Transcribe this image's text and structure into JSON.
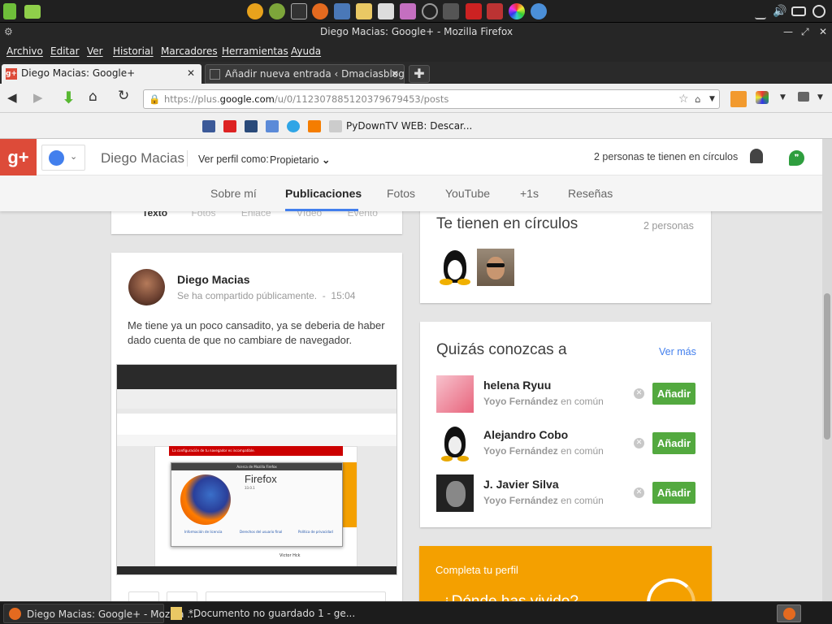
{
  "window": {
    "title": "Diego Macias: Google+ - Mozilla Firefox"
  },
  "menu": [
    "Archivo",
    "Editar",
    "Ver",
    "Historial",
    "Marcadores",
    "Herramientas",
    "Ayuda"
  ],
  "tabs": [
    {
      "label": "Diego Macias: Google+",
      "active": true
    },
    {
      "label": "Añadir nueva entrada ‹ Dmaciasblog ...",
      "active": false
    }
  ],
  "url": {
    "prefix": "https://plus.",
    "domain": "google.com",
    "path": "/u/0/112307885120379679453/posts"
  },
  "bookmarks": {
    "last_label": "PyDownTV WEB: Descar..."
  },
  "gplus": {
    "logo": "g+",
    "name": "Diego Macias",
    "view_profile_label": "Ver perfil como:",
    "view_profile_value": "Propietario",
    "circles_text": "2 personas te tienen en círculos",
    "nav": [
      "Sobre mí",
      "Publicaciones",
      "Fotos",
      "YouTube",
      "+1s",
      "Reseñas"
    ],
    "nav_active": "Publicaciones",
    "compose_tabs": [
      "Texto",
      "Fotos",
      "Enlace",
      "Vídeo",
      "Evento"
    ]
  },
  "post": {
    "author": "Diego Macias",
    "meta": "Se ha compartido públicamente.  -  15:04",
    "text": "Me tiene ya un poco cansadito, ya se deberia de haber dado cuenta de que no cambiare de navegador.",
    "shot": {
      "warning": "La configuración de tu navegador es incompatible.",
      "dialog_title": "Acerca de Mozilla Firefox",
      "firefox_label": "Firefox",
      "version": "33.0.1",
      "links": [
        "Información de licencia",
        "Derechos del usuario final",
        "Política de privacidad"
      ],
      "commenter": "Victor Hck"
    }
  },
  "circles_card": {
    "title": "Te tienen en círculos",
    "count": "2 personas"
  },
  "suggest_card": {
    "title": "Quizás conozcas a",
    "more": "Ver más",
    "people": [
      {
        "name": "helena Ryuu",
        "common_name": "Yoyo Fernández",
        "common_suffix": "en común",
        "button": "Añadir"
      },
      {
        "name": "Alejandro Cobo",
        "common_name": "Yoyo Fernández",
        "common_suffix": "en común",
        "button": "Añadir"
      },
      {
        "name": "J. Javier Silva",
        "common_name": "Yoyo Fernández",
        "common_suffix": "en común",
        "button": "Añadir"
      }
    ]
  },
  "profile_card": {
    "title": "Completa tu perfil",
    "subtitle": "¿Dónde has vivido?"
  },
  "taskbar": [
    {
      "label": "Diego Macias: Google+ - Mozilla ..."
    },
    {
      "label": "*Documento no guardado 1 - ge..."
    }
  ],
  "colors": {
    "gplus_red": "#dd4b39",
    "add_green": "#53a93f",
    "link_blue": "#427fed",
    "orange": "#f4a000"
  }
}
